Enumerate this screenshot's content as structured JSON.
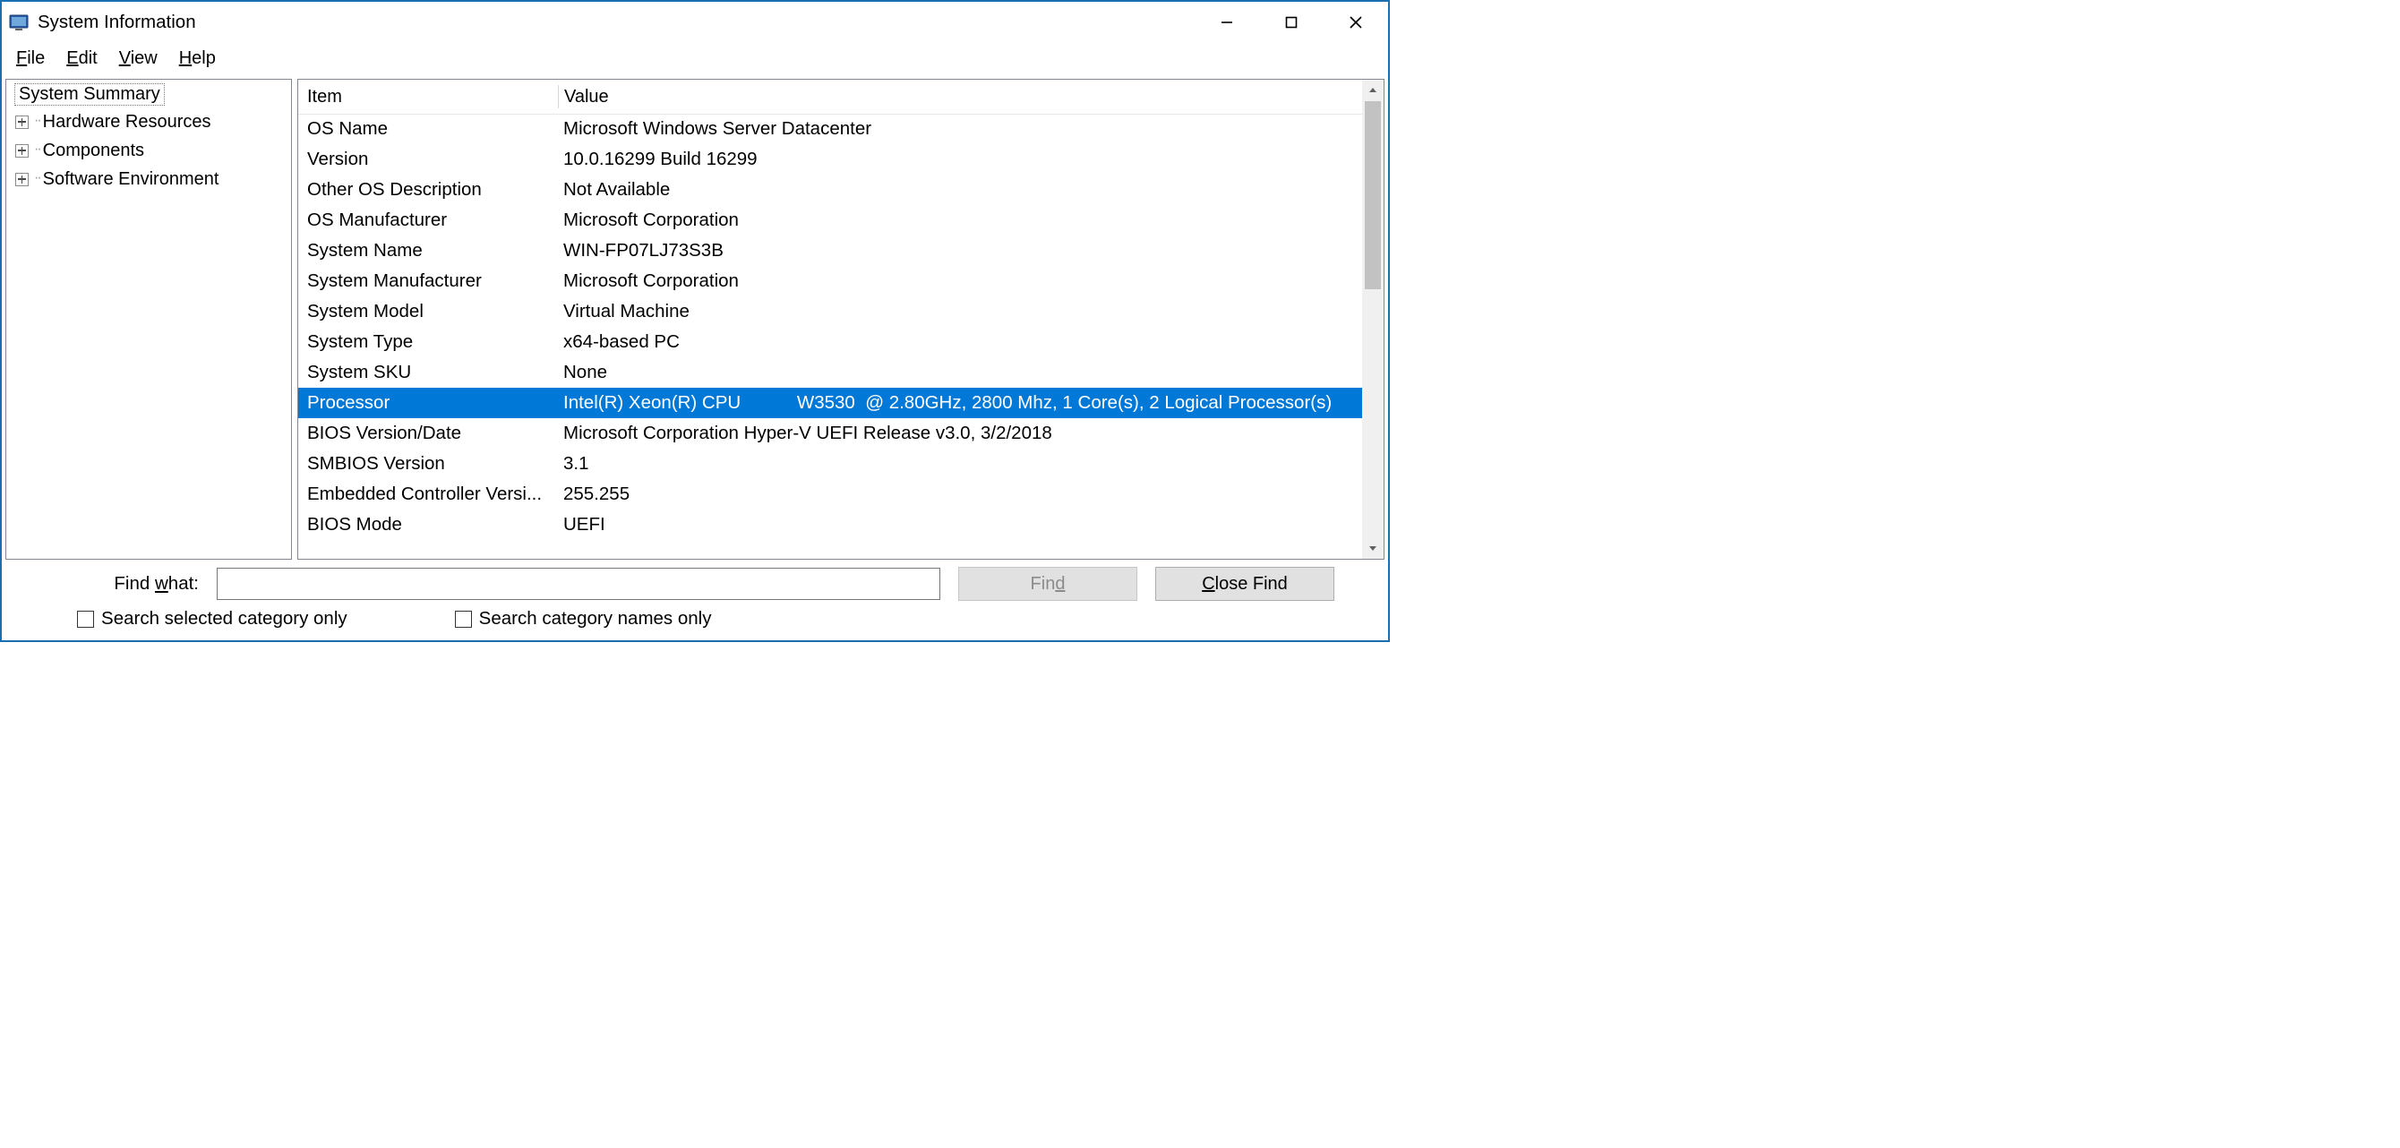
{
  "window": {
    "title": "System Information"
  },
  "menubar": [
    {
      "pre": "",
      "u": "F",
      "post": "ile"
    },
    {
      "pre": "",
      "u": "E",
      "post": "dit"
    },
    {
      "pre": "",
      "u": "V",
      "post": "iew"
    },
    {
      "pre": "",
      "u": "H",
      "post": "elp"
    }
  ],
  "tree": {
    "root": "System Summary",
    "children": [
      "Hardware Resources",
      "Components",
      "Software Environment"
    ]
  },
  "list": {
    "header_item": "Item",
    "header_value": "Value",
    "selected_index": 9,
    "rows": [
      {
        "item": "OS Name",
        "value": "Microsoft Windows Server Datacenter"
      },
      {
        "item": "Version",
        "value": "10.0.16299 Build 16299"
      },
      {
        "item": "Other OS Description",
        "value": "Not Available"
      },
      {
        "item": "OS Manufacturer",
        "value": "Microsoft Corporation"
      },
      {
        "item": "System Name",
        "value": "WIN-FP07LJ73S3B"
      },
      {
        "item": "System Manufacturer",
        "value": "Microsoft Corporation"
      },
      {
        "item": "System Model",
        "value": "Virtual Machine"
      },
      {
        "item": "System Type",
        "value": "x64-based PC"
      },
      {
        "item": "System SKU",
        "value": "None"
      },
      {
        "item": "Processor",
        "value": "Intel(R) Xeon(R) CPU           W3530  @ 2.80GHz, 2800 Mhz, 1 Core(s), 2 Logical Processor(s)"
      },
      {
        "item": "BIOS Version/Date",
        "value": "Microsoft Corporation Hyper-V UEFI Release v3.0, 3/2/2018"
      },
      {
        "item": "SMBIOS Version",
        "value": "3.1"
      },
      {
        "item": "Embedded Controller Versi...",
        "value": "255.255"
      },
      {
        "item": "BIOS Mode",
        "value": "UEFI"
      }
    ]
  },
  "find": {
    "label_pre": "Find ",
    "label_u": "w",
    "label_post": "hat:",
    "value": "",
    "find_btn_pre": "Fin",
    "find_btn_u": "d",
    "find_btn_post": "",
    "close_btn_pre": "",
    "close_btn_u": "C",
    "close_btn_post": "lose Find",
    "cb1_pre": "",
    "cb1_u": "S",
    "cb1_post": "earch selected category only",
    "cb2_pre": "Sea",
    "cb2_u": "r",
    "cb2_post": "ch category names only"
  }
}
